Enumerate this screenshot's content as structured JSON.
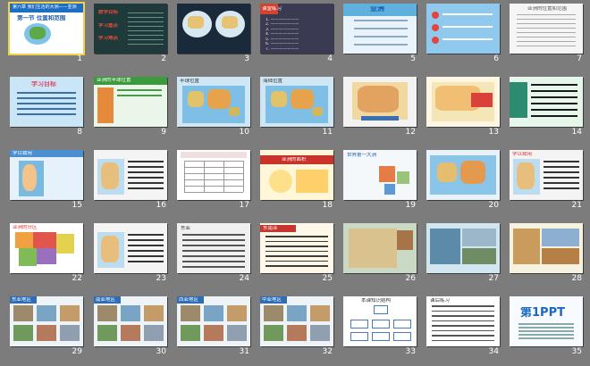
{
  "slides": [
    {
      "n": "1",
      "title": "第一节 位置和范围",
      "theme": "blue-title",
      "text": [
        "第一节 位置和范围",
        "第六章 我们生活的大洲——亚洲"
      ]
    },
    {
      "n": "2",
      "theme": "dark-green",
      "text": [
        "教学目标",
        "学习重点",
        "学习难点"
      ]
    },
    {
      "n": "3",
      "theme": "dark-map",
      "text": []
    },
    {
      "n": "4",
      "theme": "dark-questions",
      "text": [
        "课堂练习",
        "1.",
        "2.",
        "3.",
        "4.",
        "5.",
        "6.",
        "7."
      ]
    },
    {
      "n": "5",
      "theme": "teal",
      "text": [
        "亚洲",
        "学习目标"
      ]
    },
    {
      "n": "6",
      "theme": "sky",
      "text": [
        "学习要点"
      ]
    },
    {
      "n": "7",
      "theme": "text-light",
      "text": [
        "亚洲的位置和范围"
      ]
    },
    {
      "n": "8",
      "theme": "sky-title",
      "text": [
        "学习目标"
      ]
    },
    {
      "n": "9",
      "theme": "green-sidebar",
      "text": [
        "亚洲的半球位置"
      ]
    },
    {
      "n": "10",
      "theme": "world-map",
      "text": [
        "半球位置"
      ]
    },
    {
      "n": "11",
      "theme": "world-map",
      "text": [
        "海陆位置"
      ]
    },
    {
      "n": "12",
      "theme": "asia-map",
      "text": [
        "亚洲"
      ]
    },
    {
      "n": "13",
      "theme": "asia-map-red",
      "text": []
    },
    {
      "n": "14",
      "theme": "sea-sidebar",
      "text": [
        "亚洲的范围"
      ]
    },
    {
      "n": "15",
      "theme": "america-map",
      "text": [
        "学以致用"
      ]
    },
    {
      "n": "16",
      "theme": "map-text",
      "text": []
    },
    {
      "n": "17",
      "theme": "table",
      "text": [
        "表格"
      ]
    },
    {
      "n": "18",
      "theme": "red-banner",
      "text": [
        "亚洲的面积"
      ]
    },
    {
      "n": "19",
      "theme": "shapes",
      "text": [
        "世界第一大洲"
      ]
    },
    {
      "n": "20",
      "theme": "world-globe",
      "text": []
    },
    {
      "n": "21",
      "theme": "map-text",
      "text": [
        "学以致用"
      ]
    },
    {
      "n": "22",
      "theme": "asia-regions",
      "text": [
        "亚洲的分区"
      ]
    },
    {
      "n": "23",
      "theme": "map-text",
      "text": []
    },
    {
      "n": "24",
      "theme": "gray-text",
      "text": [
        "东亚"
      ]
    },
    {
      "n": "25",
      "theme": "red-text",
      "text": [
        "东南亚"
      ]
    },
    {
      "n": "26",
      "theme": "sand-map",
      "text": []
    },
    {
      "n": "27",
      "theme": "water-photo",
      "text": []
    },
    {
      "n": "28",
      "theme": "desert-photo",
      "text": []
    },
    {
      "n": "29",
      "theme": "photos",
      "text": [
        "东亚地区"
      ]
    },
    {
      "n": "30",
      "theme": "photos",
      "text": [
        "南亚地区"
      ]
    },
    {
      "n": "31",
      "theme": "photos",
      "text": [
        "西亚地区"
      ]
    },
    {
      "n": "32",
      "theme": "photos",
      "text": [
        "中亚地区"
      ]
    },
    {
      "n": "33",
      "theme": "diagram",
      "text": [
        "本课知识结构"
      ]
    },
    {
      "n": "34",
      "theme": "questions",
      "text": [
        "课后练习"
      ]
    },
    {
      "n": "35",
      "theme": "logo",
      "text": [
        "第1PPT"
      ]
    }
  ],
  "colors": {
    "background": "#7c7c7c",
    "selected": "#f3d24a",
    "slide_number": "#ffffff"
  },
  "selected_slide": "1"
}
